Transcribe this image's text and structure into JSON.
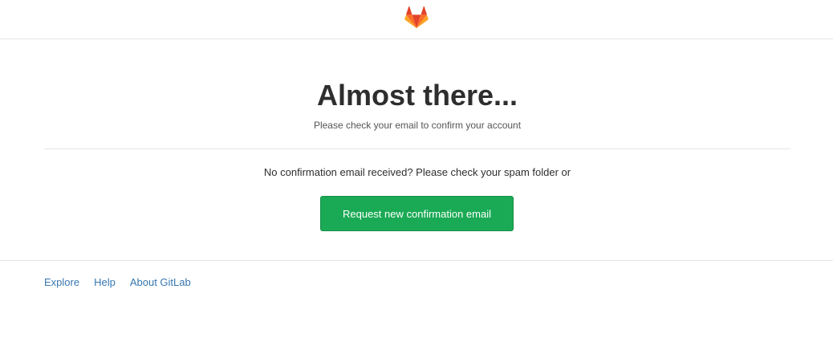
{
  "header": {
    "logo_icon": "gitlab-tanuki-logo",
    "logo_colors": [
      "#e24329",
      "#fc6d26",
      "#fca326"
    ]
  },
  "main": {
    "title": "Almost there...",
    "subtitle": "Please check your email to confirm your account",
    "notice": "No confirmation email received? Please check your spam folder or",
    "button_label": "Request new confirmation email",
    "button_color": "#1aaa55"
  },
  "footer": {
    "links": [
      "Explore",
      "Help",
      "About GitLab"
    ],
    "link_color": "#3777b0"
  }
}
